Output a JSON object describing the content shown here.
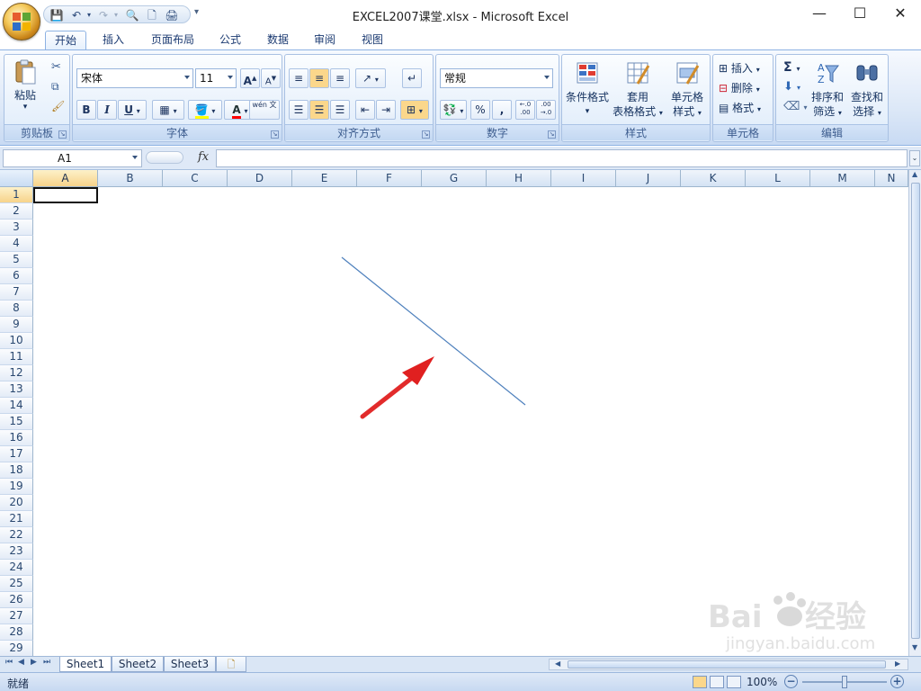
{
  "window": {
    "title": "EXCEL2007课堂.xlsx - Microsoft Excel",
    "minimize": "—",
    "maximize": "☐",
    "close": "✕"
  },
  "qat": {
    "more": "▾"
  },
  "tabs": [
    "开始",
    "插入",
    "页面布局",
    "公式",
    "数据",
    "审阅",
    "视图"
  ],
  "ribbon": {
    "clipboard": {
      "paste": "粘贴",
      "label": "剪贴板"
    },
    "font": {
      "name": "宋体",
      "size": "11",
      "grow": "A",
      "shrink": "A",
      "bold": "B",
      "italic": "I",
      "underline": "U",
      "font_color": "A",
      "phonetic": "wén 文",
      "label": "字体"
    },
    "alignment": {
      "label": "对齐方式"
    },
    "number": {
      "format": "常规",
      "percent": "%",
      "comma": ",",
      "inc_decimal": "←.0 .00",
      "dec_decimal": ".00 →.0",
      "label": "数字"
    },
    "styles": {
      "conditional": "条件格式",
      "table_1": "套用",
      "table_2": "表格格式",
      "cell_1": "单元格",
      "cell_2": "样式",
      "label": "样式"
    },
    "cells": {
      "insert": "插入",
      "delete": "删除",
      "format": "格式",
      "label": "单元格"
    },
    "editing": {
      "sum": "Σ",
      "sort_1": "排序和",
      "sort_2": "筛选",
      "find_1": "查找和",
      "find_2": "选择",
      "label": "编辑"
    }
  },
  "formula_bar": {
    "name_box": "A1",
    "fx": "fx",
    "value": ""
  },
  "grid": {
    "columns": [
      "A",
      "B",
      "C",
      "D",
      "E",
      "F",
      "G",
      "H",
      "I",
      "J",
      "K",
      "L",
      "M",
      "N"
    ],
    "rows": [
      "1",
      "2",
      "3",
      "4",
      "5",
      "6",
      "7",
      "8",
      "9",
      "10",
      "11",
      "12",
      "13",
      "14",
      "15",
      "16",
      "17",
      "18",
      "19",
      "20",
      "21",
      "22",
      "23",
      "24",
      "25",
      "26",
      "27",
      "28",
      "29"
    ],
    "line_color": "#4f81bd",
    "arrow_color": "#e02020"
  },
  "sheets": [
    "Sheet1",
    "Sheet2",
    "Sheet3"
  ],
  "status": {
    "ready": "就绪",
    "zoom": "100%"
  }
}
